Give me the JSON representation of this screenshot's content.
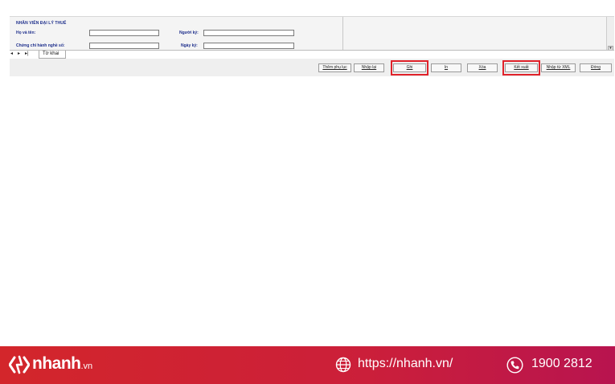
{
  "form": {
    "section_title": "NHÂN VIÊN ĐẠI LÝ THUẾ",
    "fields": {
      "full_name_label": "Họ và tên:",
      "certificate_label": "Chứng chỉ hành nghề số:",
      "signer_label": "Người ký:",
      "sign_date_label": "Ngày ký:"
    }
  },
  "tabs": {
    "nav_first": "◂",
    "nav_next": "▸",
    "nav_last": "▸|",
    "active_tab": "Tờ khai"
  },
  "toolbar": {
    "add_appendix": "Thêm phụ lục",
    "re_enter": "Nhập lại",
    "save": "Ghi",
    "print": "In",
    "delete": "Xóa",
    "export": "Kết xuất",
    "import_xml": "Nhập từ XML",
    "close": "Đóng",
    "highlight_color": "#e0222a"
  },
  "footer": {
    "brand_name": "nhanh",
    "brand_tld": ".vn",
    "website": "https://nhanh.vn/",
    "hotline": "1900 2812",
    "background_color": "#d3262b"
  }
}
